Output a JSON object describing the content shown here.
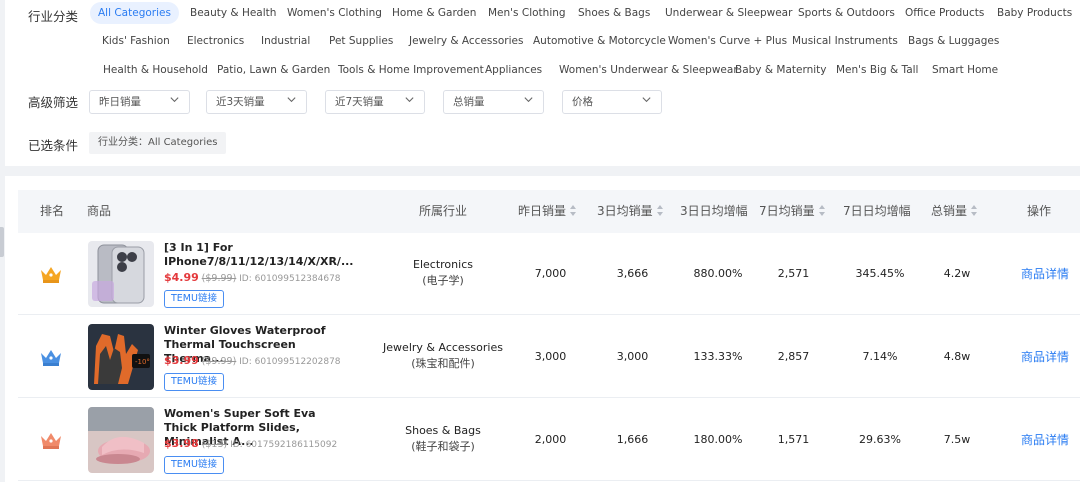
{
  "filters": {
    "category_label": "行业分类",
    "categories_row1": [
      "All Categories",
      "Beauty & Health",
      "Women's Clothing",
      "Home & Garden",
      "Men's Clothing",
      "Shoes & Bags",
      "Underwear & Sleepwear",
      "Sports & Outdoors",
      "Office Products",
      "Baby Products"
    ],
    "categories_row2": [
      "Kids' Fashion",
      "Electronics",
      "Industrial",
      "Pet Supplies",
      "Jewelry & Accessories",
      "Automotive & Motorcycle",
      "Women's Curve + Plus",
      "Musical Instruments",
      "Bags & Luggages"
    ],
    "categories_row3": [
      "Health & Household",
      "Patio, Lawn & Garden",
      "Tools & Home Improvement",
      "Appliances",
      "Women's Underwear & Sleepwear",
      "Baby & Maternity",
      "Men's Big & Tall",
      "Smart Home"
    ],
    "advanced_label": "高级筛选",
    "dropdowns": [
      "昨日销量",
      "近3天销量",
      "近7天销量",
      "总销量",
      "价格"
    ],
    "selected_label": "已选条件",
    "selected_tag": "行业分类：All Categories"
  },
  "table": {
    "headers": {
      "rank": "排名",
      "product": "商品",
      "industry": "所属行业",
      "yesterday": "昨日销量",
      "avg3": "3日均销量",
      "growth3": "3日日均增幅",
      "avg7": "7日均销量",
      "growth7": "7日日均增幅",
      "total": "总销量",
      "action": "操作"
    },
    "rows": [
      {
        "title": "[3 In 1] For IPhone7/8/11/12/13/14/X/XR/...",
        "price": "$4.99",
        "orig": "($9.99)",
        "id": "ID: 601099512384678",
        "temu": "TEMU链接",
        "industry_en": "Electronics",
        "industry_cn": "(电子学)",
        "yesterday": "7,000",
        "avg3": "3,666",
        "growth3": "880.00%",
        "avg7": "2,571",
        "growth7": "345.45%",
        "total": "4.2w",
        "detail": "商品详情",
        "crown_color": "#f5a623"
      },
      {
        "title": "Winter Gloves Waterproof Thermal Touchscreen Therma...",
        "price": "$3.99",
        "orig": "($9.99)",
        "id": "ID: 601099512202878",
        "temu": "TEMU链接",
        "industry_en": "Jewelry & Accessories",
        "industry_cn": "(珠宝和配件)",
        "yesterday": "3,000",
        "avg3": "3,000",
        "growth3": "133.33%",
        "avg7": "2,857",
        "growth7": "7.14%",
        "total": "4.8w",
        "detail": "商品详情",
        "crown_color": "#4a90e2"
      },
      {
        "title": "Women's Super Soft Eva Thick Platform Slides, Minimalist A...",
        "price": "$3.98",
        "orig": "($13)",
        "id": "ID: 6017592186115092",
        "temu": "TEMU链接",
        "industry_en": "Shoes & Bags",
        "industry_cn": "(鞋子和袋子)",
        "yesterday": "2,000",
        "avg3": "1,666",
        "growth3": "180.00%",
        "avg7": "1,571",
        "growth7": "29.63%",
        "total": "7.5w",
        "detail": "商品详情",
        "crown_color": "#f08a6a"
      }
    ]
  }
}
